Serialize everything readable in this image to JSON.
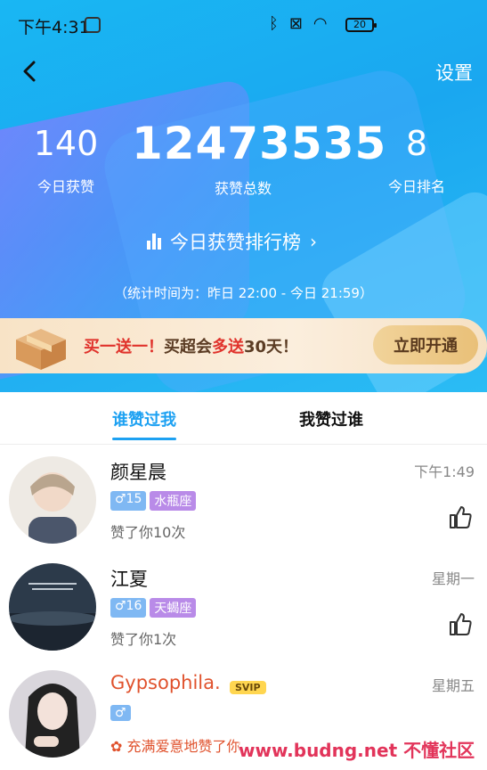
{
  "status": {
    "time": "下午4:31",
    "battery": "20"
  },
  "header": {
    "settings_label": "设置"
  },
  "stats": {
    "today_likes": "140",
    "today_likes_label": "今日获赞",
    "total_likes": "12473535",
    "total_likes_label": "获赞总数",
    "today_rank": "8",
    "today_rank_label": "今日排名",
    "rank_link": "今日获赞排行榜",
    "period": "（统计时间为：昨日 22:00 - 今日 21:59）"
  },
  "promo": {
    "text_a": "买一送一！",
    "text_b": "买超会",
    "text_c": "多送",
    "text_d": "30天！",
    "button": "立即开通"
  },
  "tabs": [
    "谁赞过我",
    "我赞过谁"
  ],
  "list": [
    {
      "name": "颜星晨",
      "gender": "♂15",
      "zodiac": "水瓶座",
      "count": "赞了你10次",
      "time": "下午1:49"
    },
    {
      "name": "江夏",
      "gender": "♂16",
      "zodiac": "天蝎座",
      "count": "赞了你1次",
      "time": "星期一"
    },
    {
      "name": "Gypsophila.",
      "badge": "SVIP",
      "gender": "♂",
      "count": "充满爱意地赞了你",
      "time": "星期五"
    }
  ],
  "watermark": "www.budng.net 不懂社区",
  "colors": {
    "accent": "#1da1f2",
    "hero": "#19b7f3",
    "promo_red": "#e0322b"
  }
}
